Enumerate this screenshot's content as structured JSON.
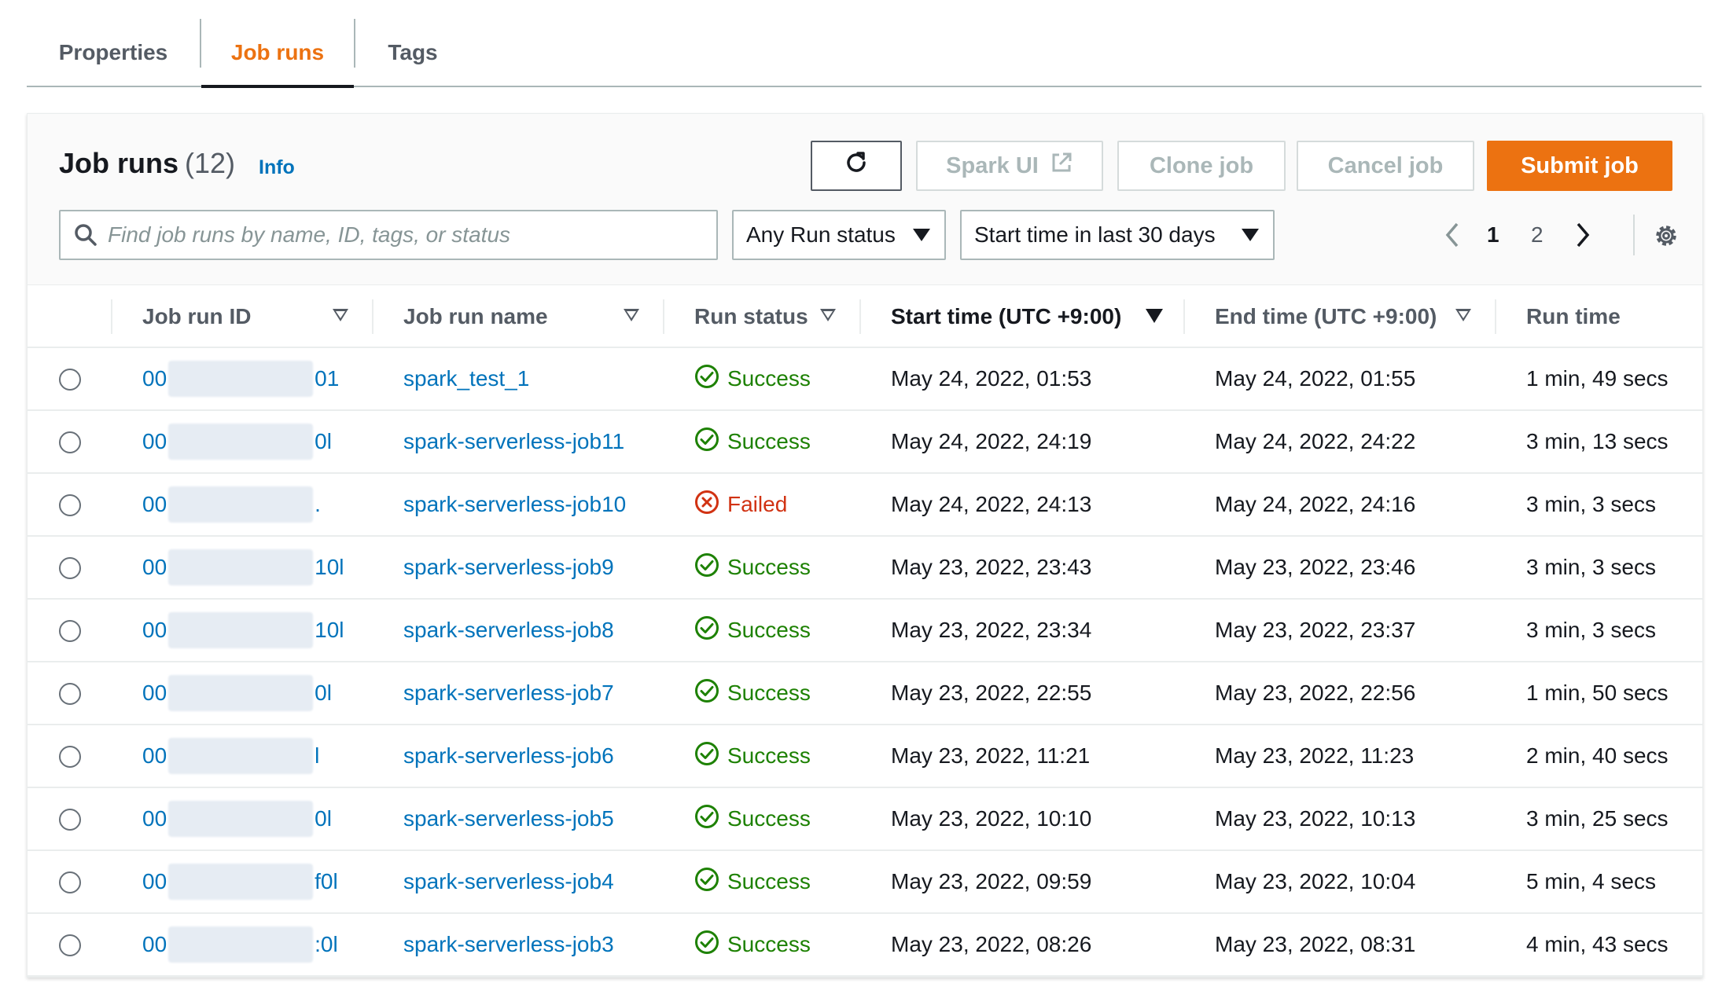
{
  "tabs": [
    {
      "label": "Properties",
      "active": false
    },
    {
      "label": "Job runs",
      "active": true
    },
    {
      "label": "Tags",
      "active": false
    }
  ],
  "panel": {
    "title": "Job runs",
    "count": "(12)",
    "info_label": "Info",
    "buttons": {
      "refresh_icon": "refresh-icon",
      "spark_ui": "Spark UI",
      "spark_ui_icon": "external-link-icon",
      "clone_job": "Clone job",
      "cancel_job": "Cancel job",
      "submit_job": "Submit job"
    },
    "search": {
      "placeholder": "Find job runs by name, ID, tags, or status",
      "value": ""
    },
    "filters": {
      "run_status": "Any Run status",
      "start_time": "Start time in last 30 days"
    },
    "pagination": {
      "pages": [
        "1",
        "2"
      ],
      "current_page": "1"
    }
  },
  "colors": {
    "accent": "#ec7211",
    "link": "#0073bb",
    "success": "#1d8102",
    "failed": "#d13212"
  },
  "table": {
    "headers": {
      "job_run_id": "Job run ID",
      "job_run_name": "Job run name",
      "run_status": "Run status",
      "start_time": "Start time (UTC +9:00)",
      "end_time": "End time (UTC +9:00)",
      "run_time": "Run time"
    },
    "rows": [
      {
        "id_prefix": "00",
        "id_suffix": "01",
        "name": "spark_test_1",
        "status": "Success",
        "start": "May 24, 2022, 01:53",
        "end": "May 24, 2022, 01:55",
        "run_time": "1 min, 49 secs"
      },
      {
        "id_prefix": "00",
        "id_suffix": "0l",
        "name": "spark-serverless-job11",
        "status": "Success",
        "start": "May 24, 2022, 24:19",
        "end": "May 24, 2022, 24:22",
        "run_time": "3 min, 13 secs"
      },
      {
        "id_prefix": "00",
        "id_suffix": ".",
        "name": "spark-serverless-job10",
        "status": "Failed",
        "start": "May 24, 2022, 24:13",
        "end": "May 24, 2022, 24:16",
        "run_time": "3 min, 3 secs"
      },
      {
        "id_prefix": "00",
        "id_suffix": "10l",
        "name": "spark-serverless-job9",
        "status": "Success",
        "start": "May 23, 2022, 23:43",
        "end": "May 23, 2022, 23:46",
        "run_time": "3 min, 3 secs"
      },
      {
        "id_prefix": "00",
        "id_suffix": "10l",
        "name": "spark-serverless-job8",
        "status": "Success",
        "start": "May 23, 2022, 23:34",
        "end": "May 23, 2022, 23:37",
        "run_time": "3 min, 3 secs"
      },
      {
        "id_prefix": "00",
        "id_suffix": "0l",
        "name": "spark-serverless-job7",
        "status": "Success",
        "start": "May 23, 2022, 22:55",
        "end": "May 23, 2022, 22:56",
        "run_time": "1 min, 50 secs"
      },
      {
        "id_prefix": "00",
        "id_suffix": "l",
        "name": "spark-serverless-job6",
        "status": "Success",
        "start": "May 23, 2022, 11:21",
        "end": "May 23, 2022, 11:23",
        "run_time": "2 min, 40 secs"
      },
      {
        "id_prefix": "00",
        "id_suffix": "0l",
        "name": "spark-serverless-job5",
        "status": "Success",
        "start": "May 23, 2022, 10:10",
        "end": "May 23, 2022, 10:13",
        "run_time": "3 min, 25 secs"
      },
      {
        "id_prefix": "00",
        "id_suffix": "f0l",
        "name": "spark-serverless-job4",
        "status": "Success",
        "start": "May 23, 2022, 09:59",
        "end": "May 23, 2022, 10:04",
        "run_time": "5 min, 4 secs"
      },
      {
        "id_prefix": "00",
        "id_suffix": ":0l",
        "name": "spark-serverless-job3",
        "status": "Success",
        "start": "May 23, 2022, 08:26",
        "end": "May 23, 2022, 08:31",
        "run_time": "4 min, 43 secs"
      }
    ]
  }
}
